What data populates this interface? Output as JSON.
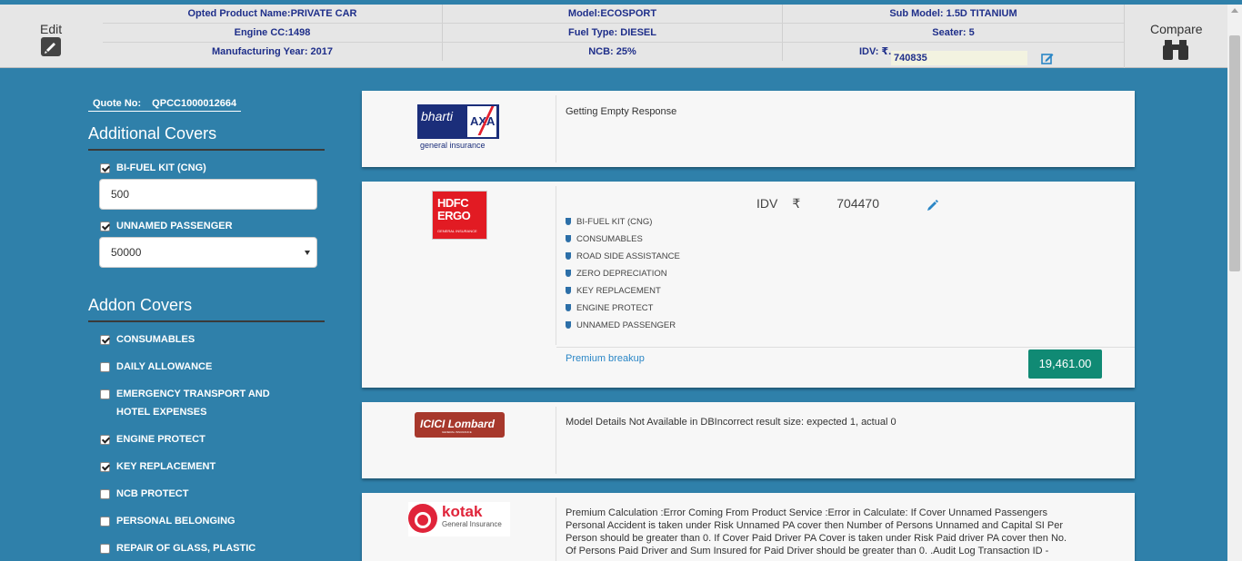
{
  "header": {
    "edit_label": "Edit",
    "compare_label": "Compare",
    "row1": [
      "Opted Product Name:PRIVATE CAR",
      "Model:ECOSPORT",
      "Sub Model: 1.5D TITANIUM"
    ],
    "row2": [
      "Engine CC:1498",
      "Fuel Type: DIESEL",
      "Seater: 5"
    ],
    "row3": [
      "Manufacturing Year: 2017",
      "NCB: 25%"
    ],
    "idv_label": "IDV: ₹.",
    "idv_value": "740835"
  },
  "sidebar": {
    "quote_label": "Quote No:",
    "quote_no": "QPCC1000012664",
    "additional_title": "Additional Covers",
    "bifuel_label": "BI-FUEL KIT (CNG)",
    "bifuel_value": "500",
    "unnamed_label": "UNNAMED PASSENGER",
    "unnamed_value": "50000",
    "addon_title": "Addon Covers",
    "addons": [
      {
        "label": "CONSUMABLES",
        "checked": true
      },
      {
        "label": "DAILY ALLOWANCE",
        "checked": false
      },
      {
        "label": "EMERGENCY TRANSPORT AND",
        "label2": "HOTEL EXPENSES",
        "checked": false
      },
      {
        "label": "ENGINE PROTECT",
        "checked": true
      },
      {
        "label": "KEY REPLACEMENT",
        "checked": true
      },
      {
        "label": "NCB PROTECT",
        "checked": false
      },
      {
        "label": "PERSONAL BELONGING",
        "checked": false
      },
      {
        "label": "REPAIR OF GLASS, PLASTIC",
        "checked": false
      }
    ]
  },
  "cards": {
    "bharti": {
      "logo_text": "bharti",
      "logo_axa": "AXA",
      "logo_sub": "general insurance",
      "message": "Getting Empty Response"
    },
    "hdfc": {
      "logo_line1": "HDFC",
      "logo_line2": "ERGO",
      "logo_sub": "GENERAL INSURANCE",
      "idv_label": "IDV",
      "currency": "₹",
      "idv_value": "704470",
      "addons": [
        "BI-FUEL KIT (CNG)",
        "CONSUMABLES",
        "ROAD SIDE ASSISTANCE",
        "ZERO DEPRECIATION",
        "KEY REPLACEMENT",
        "ENGINE PROTECT",
        "UNNAMED PASSENGER"
      ],
      "breakup_label": "Premium breakup",
      "premium": "19,461.00"
    },
    "icici": {
      "logo_text": "ICICI Lombard",
      "logo_sub": "GENERAL INSURANCE",
      "message": "Model Details Not Available in DBIncorrect result size: expected 1, actual 0"
    },
    "kotak": {
      "logo_text": "kotak",
      "logo_sub": "General Insurance",
      "message_lines": [
        "Premium Calculation :Error Coming From Product Service :Error in Calculate: If Cover Unnamed Passengers",
        "Personal Accident is taken under Risk Unnamed PA cover then Number of Persons Unnamed and Capital SI Per",
        "Person should be greater than 0. If Cover Paid Driver PA Cover is taken under Risk Paid driver PA cover then No.",
        "Of Persons Paid Driver and Sum Insured for Paid Driver should be greater than 0. .Audit Log Transaction ID -"
      ]
    }
  },
  "colors": {
    "page_bg": "#2f80aa",
    "premium_btn": "#108a74",
    "link": "#2a86c6"
  },
  "icons": [
    "pencil-icon",
    "binoculars-icon",
    "edit-square-icon",
    "shield-icon",
    "checkbox-icon",
    "chevron-down-icon"
  ]
}
